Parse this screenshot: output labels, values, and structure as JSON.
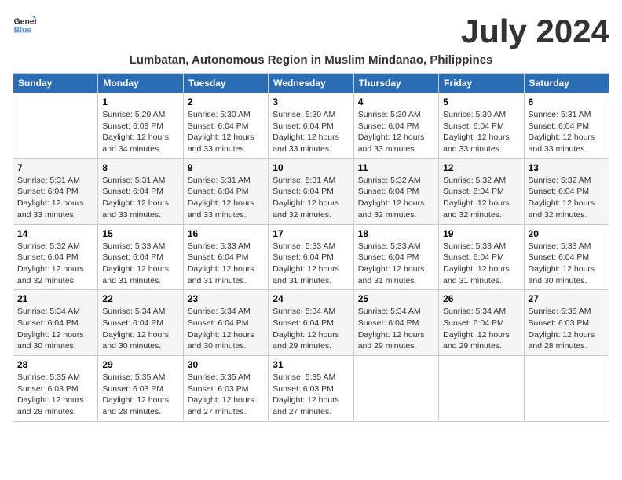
{
  "header": {
    "logo_general": "General",
    "logo_blue": "Blue",
    "month_year": "July 2024",
    "location": "Lumbatan, Autonomous Region in Muslim Mindanao, Philippines"
  },
  "days_of_week": [
    "Sunday",
    "Monday",
    "Tuesday",
    "Wednesday",
    "Thursday",
    "Friday",
    "Saturday"
  ],
  "weeks": [
    [
      {
        "day": "",
        "info": ""
      },
      {
        "day": "1",
        "info": "Sunrise: 5:29 AM\nSunset: 6:03 PM\nDaylight: 12 hours\nand 34 minutes."
      },
      {
        "day": "2",
        "info": "Sunrise: 5:30 AM\nSunset: 6:04 PM\nDaylight: 12 hours\nand 33 minutes."
      },
      {
        "day": "3",
        "info": "Sunrise: 5:30 AM\nSunset: 6:04 PM\nDaylight: 12 hours\nand 33 minutes."
      },
      {
        "day": "4",
        "info": "Sunrise: 5:30 AM\nSunset: 6:04 PM\nDaylight: 12 hours\nand 33 minutes."
      },
      {
        "day": "5",
        "info": "Sunrise: 5:30 AM\nSunset: 6:04 PM\nDaylight: 12 hours\nand 33 minutes."
      },
      {
        "day": "6",
        "info": "Sunrise: 5:31 AM\nSunset: 6:04 PM\nDaylight: 12 hours\nand 33 minutes."
      }
    ],
    [
      {
        "day": "7",
        "info": "Sunrise: 5:31 AM\nSunset: 6:04 PM\nDaylight: 12 hours\nand 33 minutes."
      },
      {
        "day": "8",
        "info": "Sunrise: 5:31 AM\nSunset: 6:04 PM\nDaylight: 12 hours\nand 33 minutes."
      },
      {
        "day": "9",
        "info": "Sunrise: 5:31 AM\nSunset: 6:04 PM\nDaylight: 12 hours\nand 33 minutes."
      },
      {
        "day": "10",
        "info": "Sunrise: 5:31 AM\nSunset: 6:04 PM\nDaylight: 12 hours\nand 32 minutes."
      },
      {
        "day": "11",
        "info": "Sunrise: 5:32 AM\nSunset: 6:04 PM\nDaylight: 12 hours\nand 32 minutes."
      },
      {
        "day": "12",
        "info": "Sunrise: 5:32 AM\nSunset: 6:04 PM\nDaylight: 12 hours\nand 32 minutes."
      },
      {
        "day": "13",
        "info": "Sunrise: 5:32 AM\nSunset: 6:04 PM\nDaylight: 12 hours\nand 32 minutes."
      }
    ],
    [
      {
        "day": "14",
        "info": "Sunrise: 5:32 AM\nSunset: 6:04 PM\nDaylight: 12 hours\nand 32 minutes."
      },
      {
        "day": "15",
        "info": "Sunrise: 5:33 AM\nSunset: 6:04 PM\nDaylight: 12 hours\nand 31 minutes."
      },
      {
        "day": "16",
        "info": "Sunrise: 5:33 AM\nSunset: 6:04 PM\nDaylight: 12 hours\nand 31 minutes."
      },
      {
        "day": "17",
        "info": "Sunrise: 5:33 AM\nSunset: 6:04 PM\nDaylight: 12 hours\nand 31 minutes."
      },
      {
        "day": "18",
        "info": "Sunrise: 5:33 AM\nSunset: 6:04 PM\nDaylight: 12 hours\nand 31 minutes."
      },
      {
        "day": "19",
        "info": "Sunrise: 5:33 AM\nSunset: 6:04 PM\nDaylight: 12 hours\nand 31 minutes."
      },
      {
        "day": "20",
        "info": "Sunrise: 5:33 AM\nSunset: 6:04 PM\nDaylight: 12 hours\nand 30 minutes."
      }
    ],
    [
      {
        "day": "21",
        "info": "Sunrise: 5:34 AM\nSunset: 6:04 PM\nDaylight: 12 hours\nand 30 minutes."
      },
      {
        "day": "22",
        "info": "Sunrise: 5:34 AM\nSunset: 6:04 PM\nDaylight: 12 hours\nand 30 minutes."
      },
      {
        "day": "23",
        "info": "Sunrise: 5:34 AM\nSunset: 6:04 PM\nDaylight: 12 hours\nand 30 minutes."
      },
      {
        "day": "24",
        "info": "Sunrise: 5:34 AM\nSunset: 6:04 PM\nDaylight: 12 hours\nand 29 minutes."
      },
      {
        "day": "25",
        "info": "Sunrise: 5:34 AM\nSunset: 6:04 PM\nDaylight: 12 hours\nand 29 minutes."
      },
      {
        "day": "26",
        "info": "Sunrise: 5:34 AM\nSunset: 6:04 PM\nDaylight: 12 hours\nand 29 minutes."
      },
      {
        "day": "27",
        "info": "Sunrise: 5:35 AM\nSunset: 6:03 PM\nDaylight: 12 hours\nand 28 minutes."
      }
    ],
    [
      {
        "day": "28",
        "info": "Sunrise: 5:35 AM\nSunset: 6:03 PM\nDaylight: 12 hours\nand 28 minutes."
      },
      {
        "day": "29",
        "info": "Sunrise: 5:35 AM\nSunset: 6:03 PM\nDaylight: 12 hours\nand 28 minutes."
      },
      {
        "day": "30",
        "info": "Sunrise: 5:35 AM\nSunset: 6:03 PM\nDaylight: 12 hours\nand 27 minutes."
      },
      {
        "day": "31",
        "info": "Sunrise: 5:35 AM\nSunset: 6:03 PM\nDaylight: 12 hours\nand 27 minutes."
      },
      {
        "day": "",
        "info": ""
      },
      {
        "day": "",
        "info": ""
      },
      {
        "day": "",
        "info": ""
      }
    ]
  ]
}
